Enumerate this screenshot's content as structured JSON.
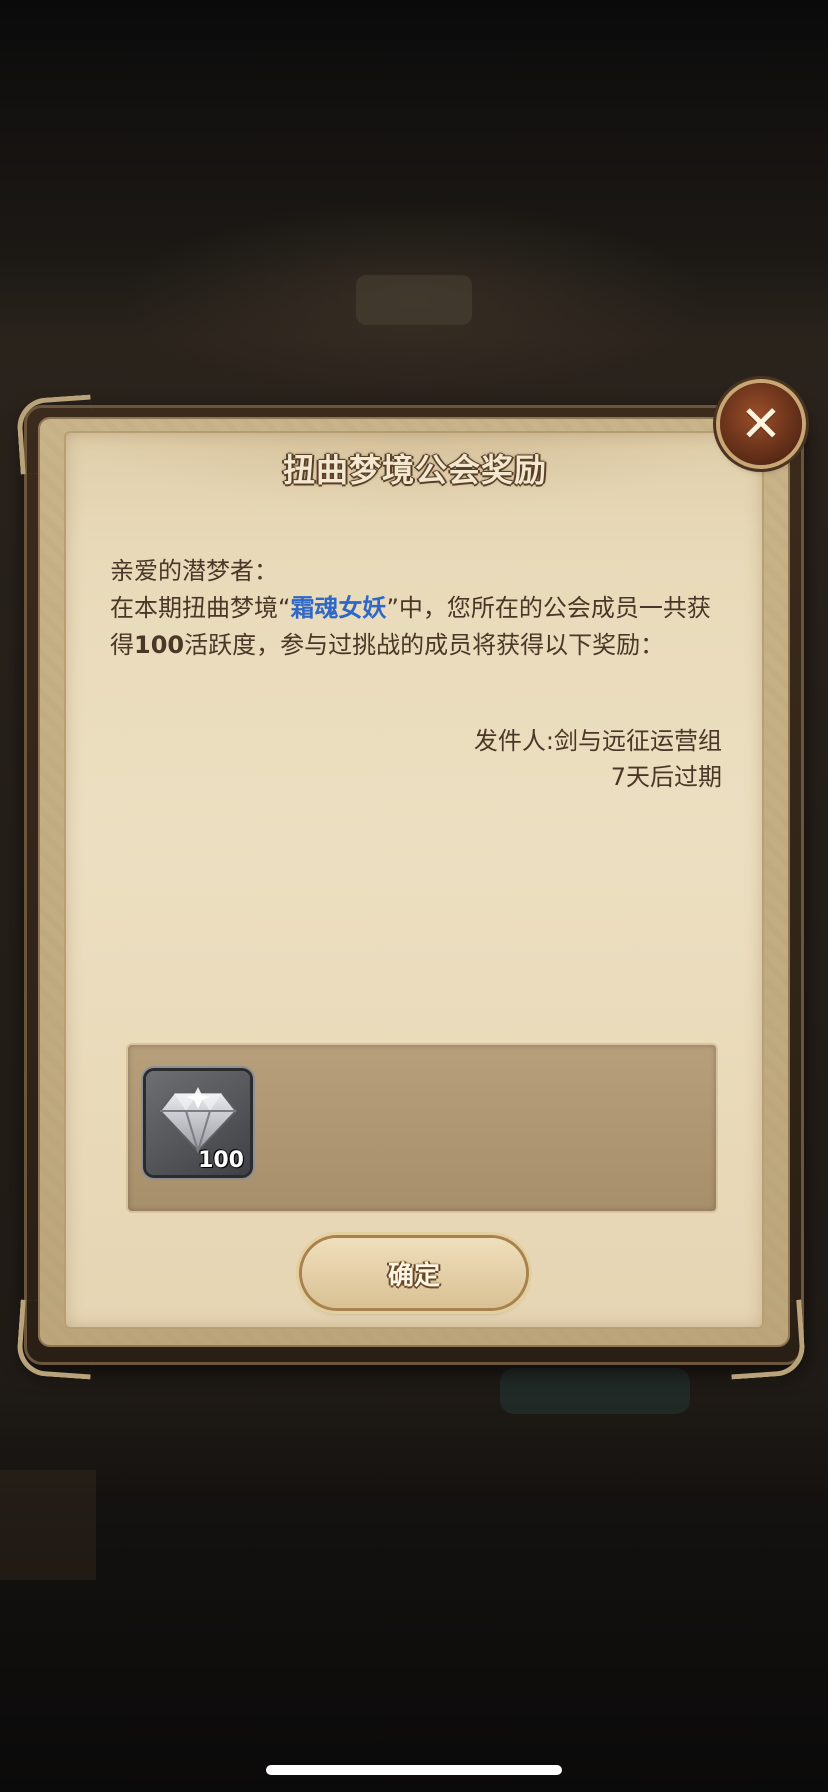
{
  "dialog": {
    "title": "扭曲梦境公会奖励",
    "close_icon": "close-icon",
    "greeting": "亲爱的潜梦者：",
    "message_part1": "在本期扭曲梦境“",
    "highlight_name": "霜魂女妖",
    "message_part2": "”中，您所在的公会成员一共获得",
    "activity_value": "100",
    "message_part3": "活跃度，参与过挑战的成员将获得以下奖励：",
    "sender": "发件人:剑与远征运营组",
    "expiry": "7天后过期",
    "reward": {
      "icon": "diamond-icon",
      "count": "100"
    },
    "confirm_label": "确定"
  },
  "colors": {
    "highlight": "#2f67c8",
    "body_text": "#4a3727",
    "paper": "#ecdfc1"
  }
}
